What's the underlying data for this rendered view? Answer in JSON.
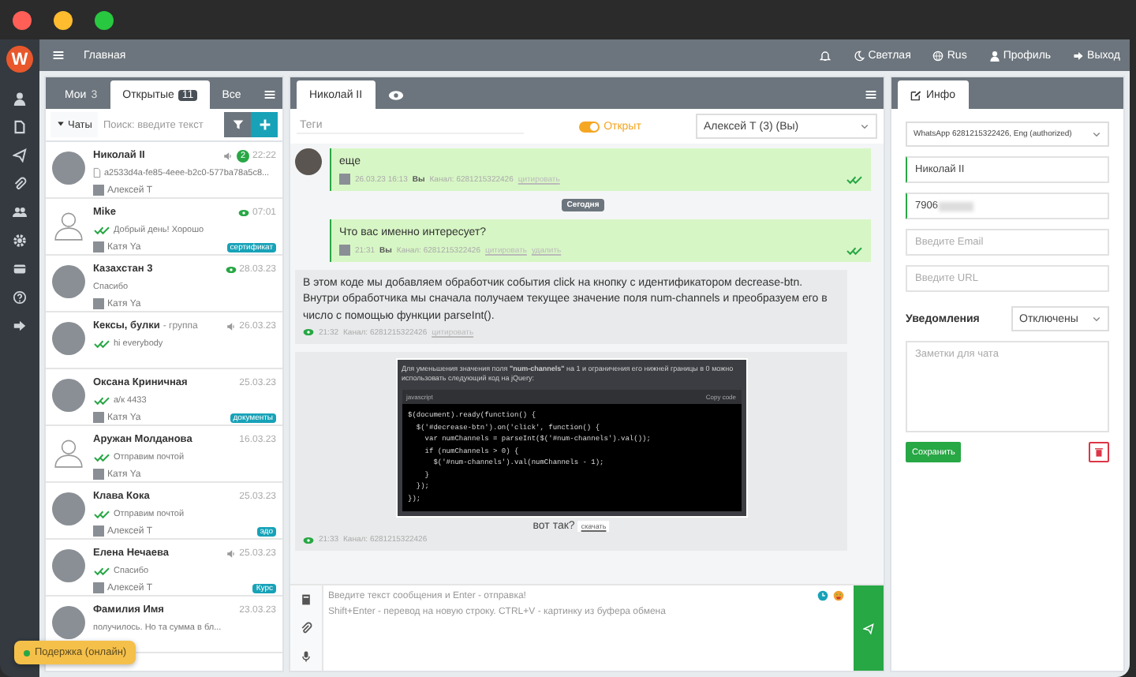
{
  "logo": "W",
  "nav": {
    "title": "Главная",
    "items": [
      {
        "kind": "theme",
        "label": "Светлая"
      },
      {
        "kind": "language",
        "label": "Rus"
      },
      {
        "kind": "profile",
        "label": "Профиль"
      },
      {
        "kind": "logout",
        "label": "Выход"
      }
    ]
  },
  "chat_list": {
    "tabs": [
      {
        "label": "Мои",
        "count": "3",
        "selected": false
      },
      {
        "label": "Открытые",
        "count": "11",
        "selected": true
      },
      {
        "label": "Все",
        "selected": false
      }
    ],
    "filter": "Чаты",
    "search": {
      "placeholder": "Поиск: введите текст"
    },
    "chats": [
      {
        "name": "Николай II",
        "time": "22:22",
        "unread": "2",
        "muted": true,
        "seen": false,
        "read": false,
        "file": true,
        "preview": "a2533d4a-fe85-4eee-b2c0-577ba78a5c8...",
        "agent": "Алексей Т",
        "silhouette": false
      },
      {
        "name": "Mike",
        "time": "07:01",
        "muted": false,
        "seen": true,
        "read": true,
        "file": false,
        "preview": "Добрый день! Хорошо",
        "agent": "Катя Ya",
        "tag": "сертификат",
        "silhouette": true
      },
      {
        "name": "Казахстан 3",
        "time": "28.03.23",
        "muted": false,
        "seen": true,
        "read": false,
        "file": false,
        "preview": "Спасибо",
        "agent": "Катя Ya",
        "silhouette": false
      },
      {
        "name": "Кексы, булки",
        "group": "- группа",
        "time": "26.03.23",
        "muted": true,
        "seen": false,
        "read": true,
        "file": false,
        "preview": "hi everybody",
        "silhouette": false
      },
      {
        "name": "Оксана Криничная",
        "time": "25.03.23",
        "muted": false,
        "seen": false,
        "read": true,
        "file": false,
        "preview": "а/к 4433",
        "agent": "Катя Ya",
        "tag": "документы",
        "silhouette": false
      },
      {
        "name": "Аружан Молданова",
        "time": "16.03.23",
        "muted": false,
        "seen": false,
        "read": true,
        "file": false,
        "preview": "Отправим почтой",
        "agent": "Катя Ya",
        "silhouette": true
      },
      {
        "name": "Клава Кока",
        "time": "25.03.23",
        "muted": false,
        "seen": false,
        "read": true,
        "file": false,
        "preview": "Отправим почтой",
        "agent": "Алексей Т",
        "tag": "эдо",
        "silhouette": false
      },
      {
        "name": "Елена Нечаева",
        "time": "25.03.23",
        "muted": true,
        "seen": false,
        "read": true,
        "file": false,
        "preview": "Спасибо",
        "agent": "Алексей Т",
        "tag": "Курс",
        "silhouette": false
      },
      {
        "name": "Фамилия Имя",
        "time": "23.03.23",
        "muted": false,
        "seen": false,
        "read": false,
        "file": false,
        "preview": "получилось. Но та сумма в бл...",
        "silhouette": false
      }
    ]
  },
  "chat": {
    "tab": "Николай II",
    "tags": {
      "placeholder": "Теги"
    },
    "status": {
      "on": true,
      "label": "Открыт"
    },
    "assignee": "Алексей Т (3) (Вы)",
    "messages": [
      {
        "kind": "outgoing",
        "text": "еще",
        "time": "26.03.23 16:13",
        "author": "Вы",
        "channel": "Канал: 6281215322426",
        "actions": [
          "цитировать"
        ],
        "read": true,
        "avatar": true
      },
      {
        "kind": "date",
        "text": "Сегодня"
      },
      {
        "kind": "outgoing",
        "text": "Что вас именно интересует?",
        "time": "21:31",
        "author": "Вы",
        "channel": "Канал: 6281215322426",
        "actions": [
          "цитировать",
          "удалить"
        ],
        "read": true,
        "avatar": false
      },
      {
        "kind": "incoming",
        "text": "В этом коде мы добавляем обработчик события click на кнопку с идентификатором decrease-btn. Внутри обработчика мы сначала получаем текущее значение поля num-channels и преобразуем его в число с помощью функции parseInt().",
        "time": "21:32",
        "channel": "Канал: 6281215322426",
        "actions": [
          "цитировать"
        ],
        "seen": true
      },
      {
        "kind": "incoming",
        "attachment": {
          "intro": "Для уменьшения значения поля **\"num-channels\"** на 1 и ограничения его нижней границы в 0 можно использовать следующий код на jQuery:",
          "lang": "javascript",
          "copy": "Copy code",
          "code": [
            "$(document).ready(function() {",
            "  $('#decrease-btn').on('click', function() {",
            "    var numChannels = parseInt($('#num-channels').val());",
            "    if (numChannels > 0) {",
            "      $('#num-channels').val(numChannels - 1);",
            "    }",
            "  });",
            "});"
          ]
        },
        "caption": "вот так?",
        "link": "скачать",
        "time": "21:33",
        "channel": "Канал: 6281215322426",
        "seen": true
      }
    ],
    "composer": {
      "placeholder": "Введите текст сообщения и Enter - отправка!\nShift+Enter - перевод на новую строку. CTRL+V - картинку из буфера обмена"
    }
  },
  "info": {
    "tab": "Инфо",
    "channel": "WhatsApp 6281215322426, Eng (authorized)",
    "name": "Николай II",
    "phone": "7906",
    "email": {
      "placeholder": "Введите Email"
    },
    "url": {
      "placeholder": "Введите URL"
    },
    "notifications": {
      "label": "Уведомления",
      "value": "Отключены"
    },
    "notes": {
      "placeholder": "Заметки для чата"
    },
    "save": "Сохранить"
  },
  "support": {
    "label": "Подержка (онлайн)",
    "online": true
  }
}
